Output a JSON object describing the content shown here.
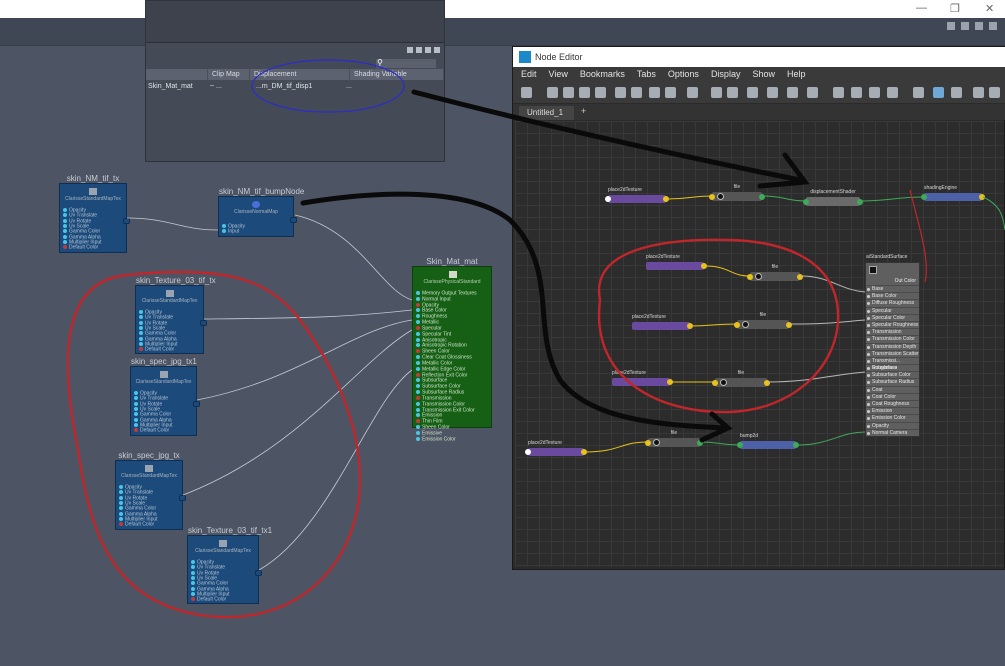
{
  "window_controls": [
    "—",
    "❐",
    "✕"
  ],
  "hypershade": {
    "columns": [
      "Clip Map",
      "Displacement",
      "Shading Variable"
    ],
    "row": {
      "material": "Skin_Mat_mat",
      "clip": "~ ...",
      "displacement": "...m_DM_tif_disp1",
      "more": "..."
    }
  },
  "graph_nodes": {
    "nm_tx": {
      "title": "skin_NM_tif_tx",
      "subtitle": "ClarisseStandardMapTex",
      "attrs": [
        "Opacity",
        "Uv Translate",
        "Uv Rotate",
        "Uv Scale",
        "Gamma Color",
        "Gamma Alpha",
        "Multiplier Input",
        "Default Color"
      ]
    },
    "bump": {
      "title": "skin_NM_tif_bumpNode",
      "subtitle": "ClarisseNormalMap",
      "attrs": [
        "Opacity",
        "Input"
      ]
    },
    "tex03": {
      "title": "skin_Texture_03_tif_tx",
      "subtitle": "ClarisseStandardMapTex",
      "attrs": [
        "Opacity",
        "Uv Translate",
        "Uv Rotate",
        "Uv Scale",
        "Gamma Color",
        "Gamma Alpha",
        "Multiplier Input",
        "Default Color"
      ]
    },
    "spec1": {
      "title": "skin_spec_jpg_tx1",
      "subtitle": "ClarisseStandardMapTex",
      "attrs": [
        "Opacity",
        "Uv Translate",
        "Uv Rotate",
        "Uv Scale",
        "Gamma Color",
        "Gamma Alpha",
        "Multiplier Input",
        "Default Color"
      ]
    },
    "spec": {
      "title": "skin_spec_jpg_tx",
      "subtitle": "ClarisseStandardMapTex",
      "attrs": [
        "Opacity",
        "Uv Translate",
        "Uv Rotate",
        "Uv Scale",
        "Gamma Color",
        "Gamma Alpha",
        "Multiplier Input",
        "Default Color"
      ]
    },
    "tex03b": {
      "title": "skin_Texture_03_tif_tx1",
      "subtitle": "ClarisseStandardMapTex",
      "attrs": [
        "Opacity",
        "Uv Translate",
        "Uv Rotate",
        "Uv Scale",
        "Gamma Color",
        "Gamma Alpha",
        "Multiplier Input",
        "Default Color"
      ]
    },
    "mat": {
      "title": "Skin_Mat_mat",
      "subtitle": "ClarissePhysicalStandard",
      "attrs": [
        "Memory Output Textures",
        "Normal Input",
        "Opacity",
        "Base Color",
        "Roughness",
        "Metallic",
        "Specular",
        "Specular Tint",
        "Anisotropic",
        "Anisotropic Rotation",
        "Sheen Color",
        "Clear Coat Glossiness",
        "Metallic Color",
        "Metallic Edge Color",
        "Reflection Exit Color",
        "Subsurface",
        "Subsurface Color",
        "Subsurface Radius",
        "Transmission",
        "Transmission Color",
        "Transmission Exit Color",
        "Emission",
        "Thin Film",
        "Sheen Color",
        "Emissive",
        "Emission Color"
      ]
    }
  },
  "node_editor": {
    "title": "Node Editor",
    "menu": [
      "Edit",
      "View",
      "Bookmarks",
      "Tabs",
      "Options",
      "Display",
      "Show",
      "Help"
    ],
    "tab": "Untitled_1",
    "tab_add": "+",
    "nodes": {
      "p2d_top": "place2dTexture",
      "file_top": "file",
      "disp": "displacementShader",
      "sg": "shadingEngine",
      "p2d_1": "place2dTexture",
      "file_1": "file",
      "p2d_2": "place2dTexture",
      "file_2": "file",
      "p2d_3": "place2dTexture",
      "file_3": "file",
      "p2d_4": "place2dTexture",
      "file_4": "file",
      "bump2d": "bump2d",
      "ai": "aiStandardSurface",
      "ai_out": "Out Color",
      "ai_attrs": [
        "Base",
        "Base Color",
        "Diffuse Roughness",
        "Specular",
        "Specular Color",
        "Specular Roughness",
        "Transmission",
        "Transmission Color",
        "Transmission Depth",
        "Transmission Scatter",
        "Transmissi... Roughness",
        "Subsurface",
        "Subsurface Color",
        "Subsurface Radius",
        "Coat",
        "Coat Color",
        "Coat Roughness",
        "Emission",
        "Emission Color",
        "Opacity",
        "Normal Camera"
      ]
    }
  },
  "colors": {
    "annotation_red": "#c0262a",
    "annotation_blue": "#2b2bd0",
    "arrow_black": "#0a0a0a"
  }
}
